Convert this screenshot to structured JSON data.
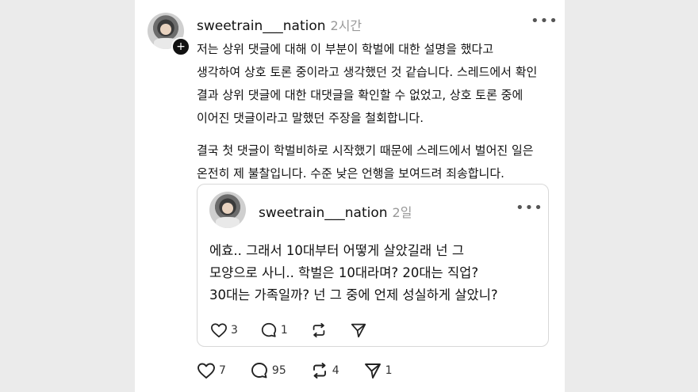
{
  "post": {
    "username": "sweetrain___nation",
    "time": "2시간",
    "more_icon": "more-horizontal-icon",
    "paragraph1": [
      "저는 상위 댓글에 대해 이 부분이 학벌에 대한 설명을 했다고",
      "생각하여 상호 토론 중이라고 생각했던 것 같습니다. 스레드에서 확인",
      "결과 상위 댓글에 대한 대댓글을 확인할 수 없었고, 상호 토론 중에",
      "이어진 댓글이라고 말했던 주장을 철회합니다."
    ],
    "paragraph2": [
      "결국 첫 댓글이 학벌비하로 시작했기 때문에 스레드에서 벌어진 일은",
      "온전히 제 불찰입니다. 수준 낮은 언행을 보여드려 죄송합니다."
    ],
    "actions": {
      "likes": "7",
      "comments": "95",
      "reposts": "4",
      "shares": "1"
    }
  },
  "quoted_post": {
    "username": "sweetrain___nation",
    "time": "2일",
    "lines": [
      "에효.. 그래서 10대부터 어떻게 살았길래 넌 그",
      "모양으로 사니.. 학벌은 10대라며? 20대는 직업?",
      "30대는 가족일까? 넌 그 중에 언제 성실하게 살았니?"
    ],
    "actions": {
      "likes": "3",
      "comments": "1"
    }
  }
}
